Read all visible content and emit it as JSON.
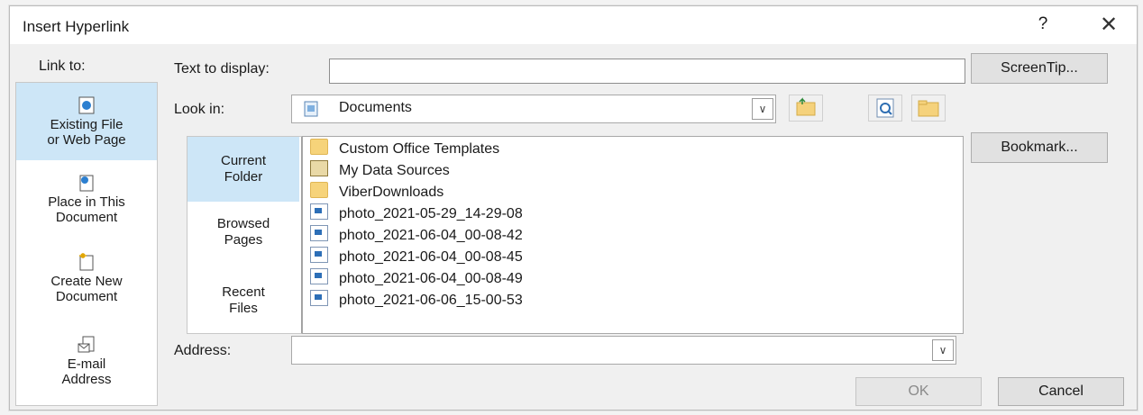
{
  "dialog": {
    "title": "Insert Hyperlink",
    "help": "?",
    "close": "✕"
  },
  "link_to": {
    "label": "Link to:",
    "items": [
      {
        "line1": "Existing File",
        "line2": "or Web Page",
        "icon": "web-page-icon",
        "selected": true
      },
      {
        "line1": "Place in This",
        "line2": "Document",
        "icon": "place-in-document-icon",
        "selected": false
      },
      {
        "line1": "Create New",
        "line2": "Document",
        "icon": "new-document-icon",
        "selected": false
      },
      {
        "line1": "E-mail",
        "line2": "Address",
        "icon": "email-icon",
        "selected": false
      }
    ]
  },
  "text_to_display": {
    "label": "Text to display:",
    "value": ""
  },
  "screentip_button": "ScreenTip...",
  "look_in": {
    "label": "Look in:",
    "value": "Documents",
    "icon": "documents-folder-icon"
  },
  "toolbar_icons": [
    "browse-web-icon",
    "browse-file-icon"
  ],
  "scope": {
    "items": [
      {
        "line1": "Current",
        "line2": "Folder",
        "selected": true
      },
      {
        "line1": "Browsed",
        "line2": "Pages",
        "selected": false
      },
      {
        "line1": "Recent",
        "line2": "Files",
        "selected": false
      }
    ]
  },
  "files": [
    {
      "name": "Custom Office Templates",
      "type": "folder"
    },
    {
      "name": "My Data Sources",
      "type": "data-source"
    },
    {
      "name": "ViberDownloads",
      "type": "folder"
    },
    {
      "name": "photo_2021-05-29_14-29-08",
      "type": "image"
    },
    {
      "name": "photo_2021-06-04_00-08-42",
      "type": "image"
    },
    {
      "name": "photo_2021-06-04_00-08-45",
      "type": "image"
    },
    {
      "name": "photo_2021-06-04_00-08-49",
      "type": "image"
    },
    {
      "name": "photo_2021-06-06_15-00-53",
      "type": "image"
    }
  ],
  "bookmark_button": "Bookmark...",
  "address": {
    "label": "Address:",
    "value": ""
  },
  "ok_button": "OK",
  "cancel_button": "Cancel",
  "colors": {
    "selected": "#cde6f7",
    "dialog_bg": "#f0f0f0",
    "button_bg": "#e1e1e1"
  }
}
